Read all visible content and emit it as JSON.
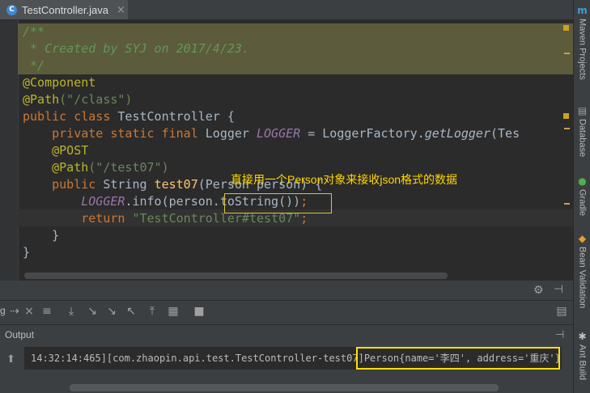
{
  "tab": {
    "icon_letter": "C",
    "label": "TestController.java",
    "close": "×"
  },
  "code": {
    "doc1": "/**",
    "doc2": " * Created by SYJ on 2017/4/23.",
    "doc3": " */",
    "ann_component": "@Component",
    "ann_path": "@Path",
    "path_value": "(\"/class\")",
    "class_decl_kw": "public class ",
    "class_name": "TestController {",
    "field_kw": "    private static final ",
    "field_type": "Logger ",
    "field_name": "LOGGER",
    "field_eq": " = LoggerFactory.",
    "field_call": "getLogger",
    "field_tail": "(Tes",
    "ann_post": "    @POST",
    "ann_path2": "    @Path",
    "path2_value": "(\"/test07\")",
    "method_kw": "    public ",
    "method_type": "String ",
    "method_name": "test07",
    "method_params": "(Person person) {",
    "log_obj": "        LOGGER",
    "log_call": ".info(person.toString())",
    "log_semi": ";",
    "ret_kw": "        return ",
    "ret_str": "\"TestController#test07\"",
    "ret_semi": ";",
    "close_method": "    }",
    "close_class": "}"
  },
  "annotation": {
    "callout": "直接用一个Person对象来接收json格式的数据"
  },
  "run_panel": {
    "tab_fragment": "g",
    "output_label": "Output",
    "output_prefix": "14:32:14:465][com.zhaopin.api.test.TestController-test07]",
    "output_highlight": "Person{name='李四', address='重庆'}"
  },
  "sidebar": {
    "maven": "Maven Projects",
    "database": "Database",
    "gradle": "Gradle",
    "bean": "Bean Validation",
    "ant": "Ant Build",
    "maven_icon": "m"
  }
}
